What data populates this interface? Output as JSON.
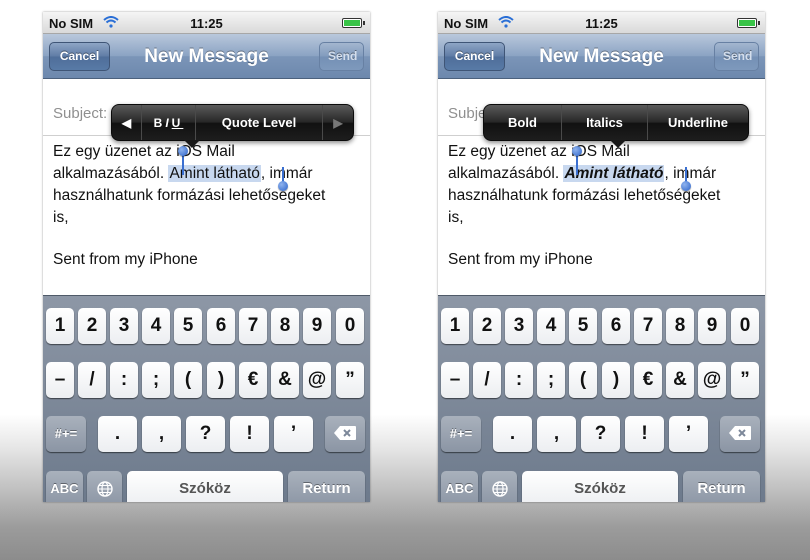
{
  "status_bar": {
    "carrier": "No SIM",
    "time": "11:25",
    "wifi_icon": "wifi-icon",
    "battery_icon": "battery-icon",
    "battery_level": 1.0
  },
  "nav": {
    "cancel": "Cancel",
    "title": "New Message",
    "send": "Send"
  },
  "subject_label": "Subject:",
  "message": {
    "line1": "Ez egy üzenet az iOS Mail",
    "line2_before": "alkalmazásából. ",
    "line2_selected": "Amint látható",
    "line2_after": ", immár",
    "line3": "használhatunk formázási lehetőségeket",
    "line4": "is,",
    "signature": "Sent from my iPhone"
  },
  "left_menu": {
    "prev_icon": "◀",
    "b": "B",
    "i": "I",
    "u": "U",
    "quote_level": "Quote Level",
    "next_icon": "▶"
  },
  "right_menu": {
    "bold": "Bold",
    "italics": "Italics",
    "underline": "Underline"
  },
  "keyboard": {
    "row1": [
      "1",
      "2",
      "3",
      "4",
      "5",
      "6",
      "7",
      "8",
      "9",
      "0"
    ],
    "row2": [
      "–",
      "/",
      ":",
      ";",
      "(",
      ")",
      "€",
      "&",
      "@",
      "”"
    ],
    "row3_symbols": "#+=",
    "row3": [
      ".",
      ",",
      "?",
      "!",
      "’"
    ],
    "abc": "ABC",
    "space": "Szóköz",
    "return": "Return"
  },
  "colors": {
    "nav_blue": "#6d88ad",
    "selection": "#c8d8ef",
    "handle": "#2c63c9",
    "keyboard_bg": "#7d889a"
  }
}
